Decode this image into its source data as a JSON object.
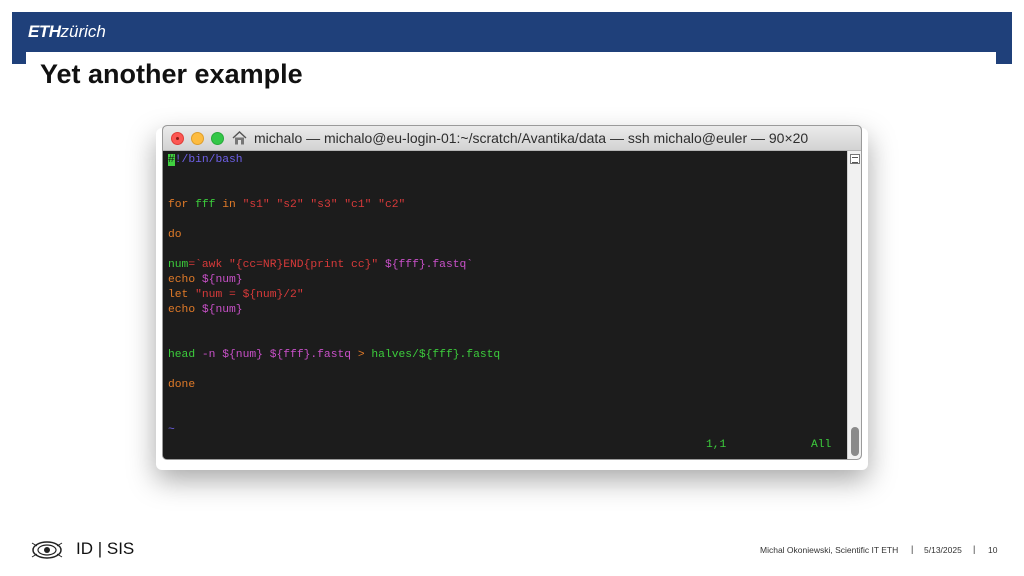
{
  "header": {
    "logo_eth": "ETH",
    "logo_zurich": "zürich",
    "background": "#1f407a"
  },
  "slide": {
    "title": "Yet another example"
  },
  "terminal": {
    "window_title": "michalo — michalo@eu-login-01:~/scratch/Avantika/data — ssh michalo@euler — 90×20",
    "traffic_lights": [
      "close-button",
      "minimize-button",
      "zoom-button"
    ],
    "title_icon": "home-folder-icon",
    "colors": {
      "background": "#1c1c1c",
      "keyword": "#e07a28",
      "variable": "#3ccc3c",
      "string": "#d83a3a",
      "var_ref": "#c850c8",
      "path": "#6e60e8"
    },
    "code": {
      "shebang_cursor": "#",
      "shebang_rest": "!/bin/bash",
      "for_kw": "for",
      "for_var": "fff",
      "in_kw": "in",
      "list": "\"s1\" \"s2\" \"s3\" \"c1\" \"c2\"",
      "do": "do",
      "num_var": "num",
      "num_assign": "=`awk \"{cc=NR}END{print cc}\" ",
      "num_ref": "${fff}.fastq`",
      "echo1_kw": "echo",
      "echo1_ref": "${num}",
      "let_kw": "let",
      "let_expr": "\"num = ${num}/2\"",
      "echo2_kw": "echo",
      "echo2_ref": "${num}",
      "head_cmd": "head",
      "head_args": " -n ${num} ${fff}.fastq ",
      "head_redirect": ">",
      "head_target": " halves/${fff}.fastq",
      "done": "done",
      "tilde": "~"
    },
    "status": {
      "position": "1,1",
      "scroll": "All"
    },
    "scrollbar": {
      "icon": "scroll-menu-icon"
    }
  },
  "footer": {
    "logo_icon": "eth-eye-logo",
    "unit": "ID | SIS",
    "author": "Michal Okoniewski, Scientific IT ETH",
    "separator": "|",
    "date": "5/13/2025",
    "page": "10"
  }
}
